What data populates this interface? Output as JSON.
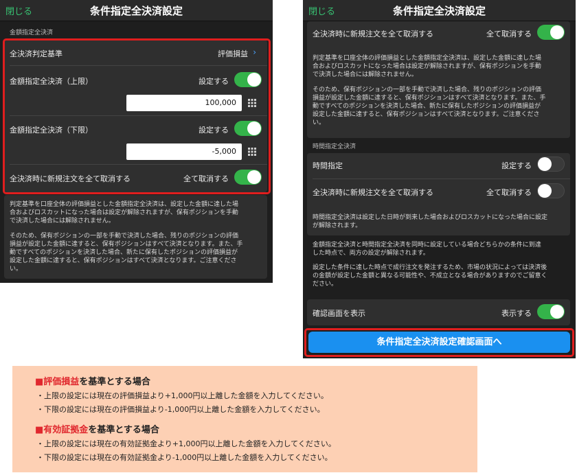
{
  "left": {
    "header": {
      "close": "閉じる",
      "title": "条件指定全決済設定"
    },
    "section_amount": "金額指定全決済",
    "basis": {
      "label": "全決済判定基準",
      "value": "評価損益"
    },
    "upper": {
      "label": "金額指定全決済（上限）",
      "toggle_label": "設定する",
      "value": "100,000"
    },
    "lower": {
      "label": "金額指定全決済（下限）",
      "toggle_label": "設定する",
      "value": "-5,000"
    },
    "cancel_orders": {
      "label": "全決済時に新規注文を全て取消する",
      "toggle_label": "全て取消する"
    },
    "note1": [
      "判定基準を口座全体の評価損益とした金額指定全決済は、設定した金額に達した場",
      "合およびロスカットになった場合は設定が解除されますが、保有ポジションを手動",
      "で決済した場合には解除されません。"
    ],
    "note2": [
      "そのため、保有ポジションの一部を手動で決済した場合、残りのポジションの評価",
      "損益が設定した金額に達すると、保有ポジションはすべて決済となります。また、手",
      "動ですべてのポジションを決済した場合、新たに保有したポジションの評価損益が",
      "設定した金額に達すると、保有ポジションはすべて決済となります。ご注意くださ",
      "い。"
    ]
  },
  "right": {
    "header": {
      "close": "閉じる",
      "title": "条件指定全決済設定"
    },
    "cancel_orders_top": {
      "label": "全決済時に新規注文を全て取消する",
      "toggle_label": "全て取消する"
    },
    "note1": [
      "判定基準を口座全体の評価損益とした金額指定全決済は、設定した金額に達した場",
      "合およびロスカットになった場合は設定が解除されますが、保有ポジションを手動",
      "で決済した場合には解除されません。"
    ],
    "note2": [
      "そのため、保有ポジションの一部を手動で決済した場合、残りのポジションの評価",
      "損益が設定した金額に達すると、保有ポジションはすべて決済となります。また、手",
      "動ですべてのポジションを決済した場合、新たに保有したポジションの評価損益が",
      "設定した金額に達すると、保有ポジションはすべて決済となります。ご注意くださ",
      "い。"
    ],
    "section_time": "時間指定全決済",
    "time": {
      "label": "時間指定",
      "toggle_label": "設定する"
    },
    "cancel_orders_time": {
      "label": "全決済時に新規注文を全て取消する",
      "toggle_label": "全て取消する"
    },
    "time_note": [
      "時間指定全決済は設定した日時が到来した場合およびロスカットになった場合に設定",
      "が解除されます。"
    ],
    "both_note": [
      "金額指定全決済と時間指定全決済を同時に設定している場合どちらかの条件に到達",
      "した時点で、両方の設定が解除されます。"
    ],
    "market_note": [
      "設定した条件に達した時点で成行注文を発注するため、市場の状況によっては決済後",
      "の金額が設定した金額と異なる可能性や、不成立となる場合がありますのでご留意く",
      "ださい。"
    ],
    "confirm_display": {
      "label": "確認画面を表示",
      "toggle_label": "表示する"
    },
    "confirm_button": "条件指定全決済設定確認画面へ"
  },
  "info": {
    "square": "■",
    "h1_keyword": "評価損益",
    "h1_rest": "を基準とする場合",
    "h1_lines": [
      "・上限の設定には現在の評価損益より+1,000円以上離した金額を入力してください。",
      "・下限の設定には現在の評価損益より-1,000円以上離した金額を入力してください。"
    ],
    "h2_keyword": "有効証拠金",
    "h2_rest": "を基準とする場合",
    "h2_lines": [
      "・上限の設定には現在の有効証拠金より+1,000円以上離した金額を入力してください。",
      "・下限の設定には現在の有効証拠金より-1,000円以上離した金額を入力してください。"
    ]
  },
  "colors": {
    "toggle_on": "#34b34a",
    "accent_green": "#38c172",
    "button_blue": "#1a90f0",
    "highlight_red": "#e01e1e",
    "info_bg": "#fdd0b4"
  },
  "icons": {
    "grid": "grid-icon",
    "chevron": "chevron-right-icon"
  }
}
